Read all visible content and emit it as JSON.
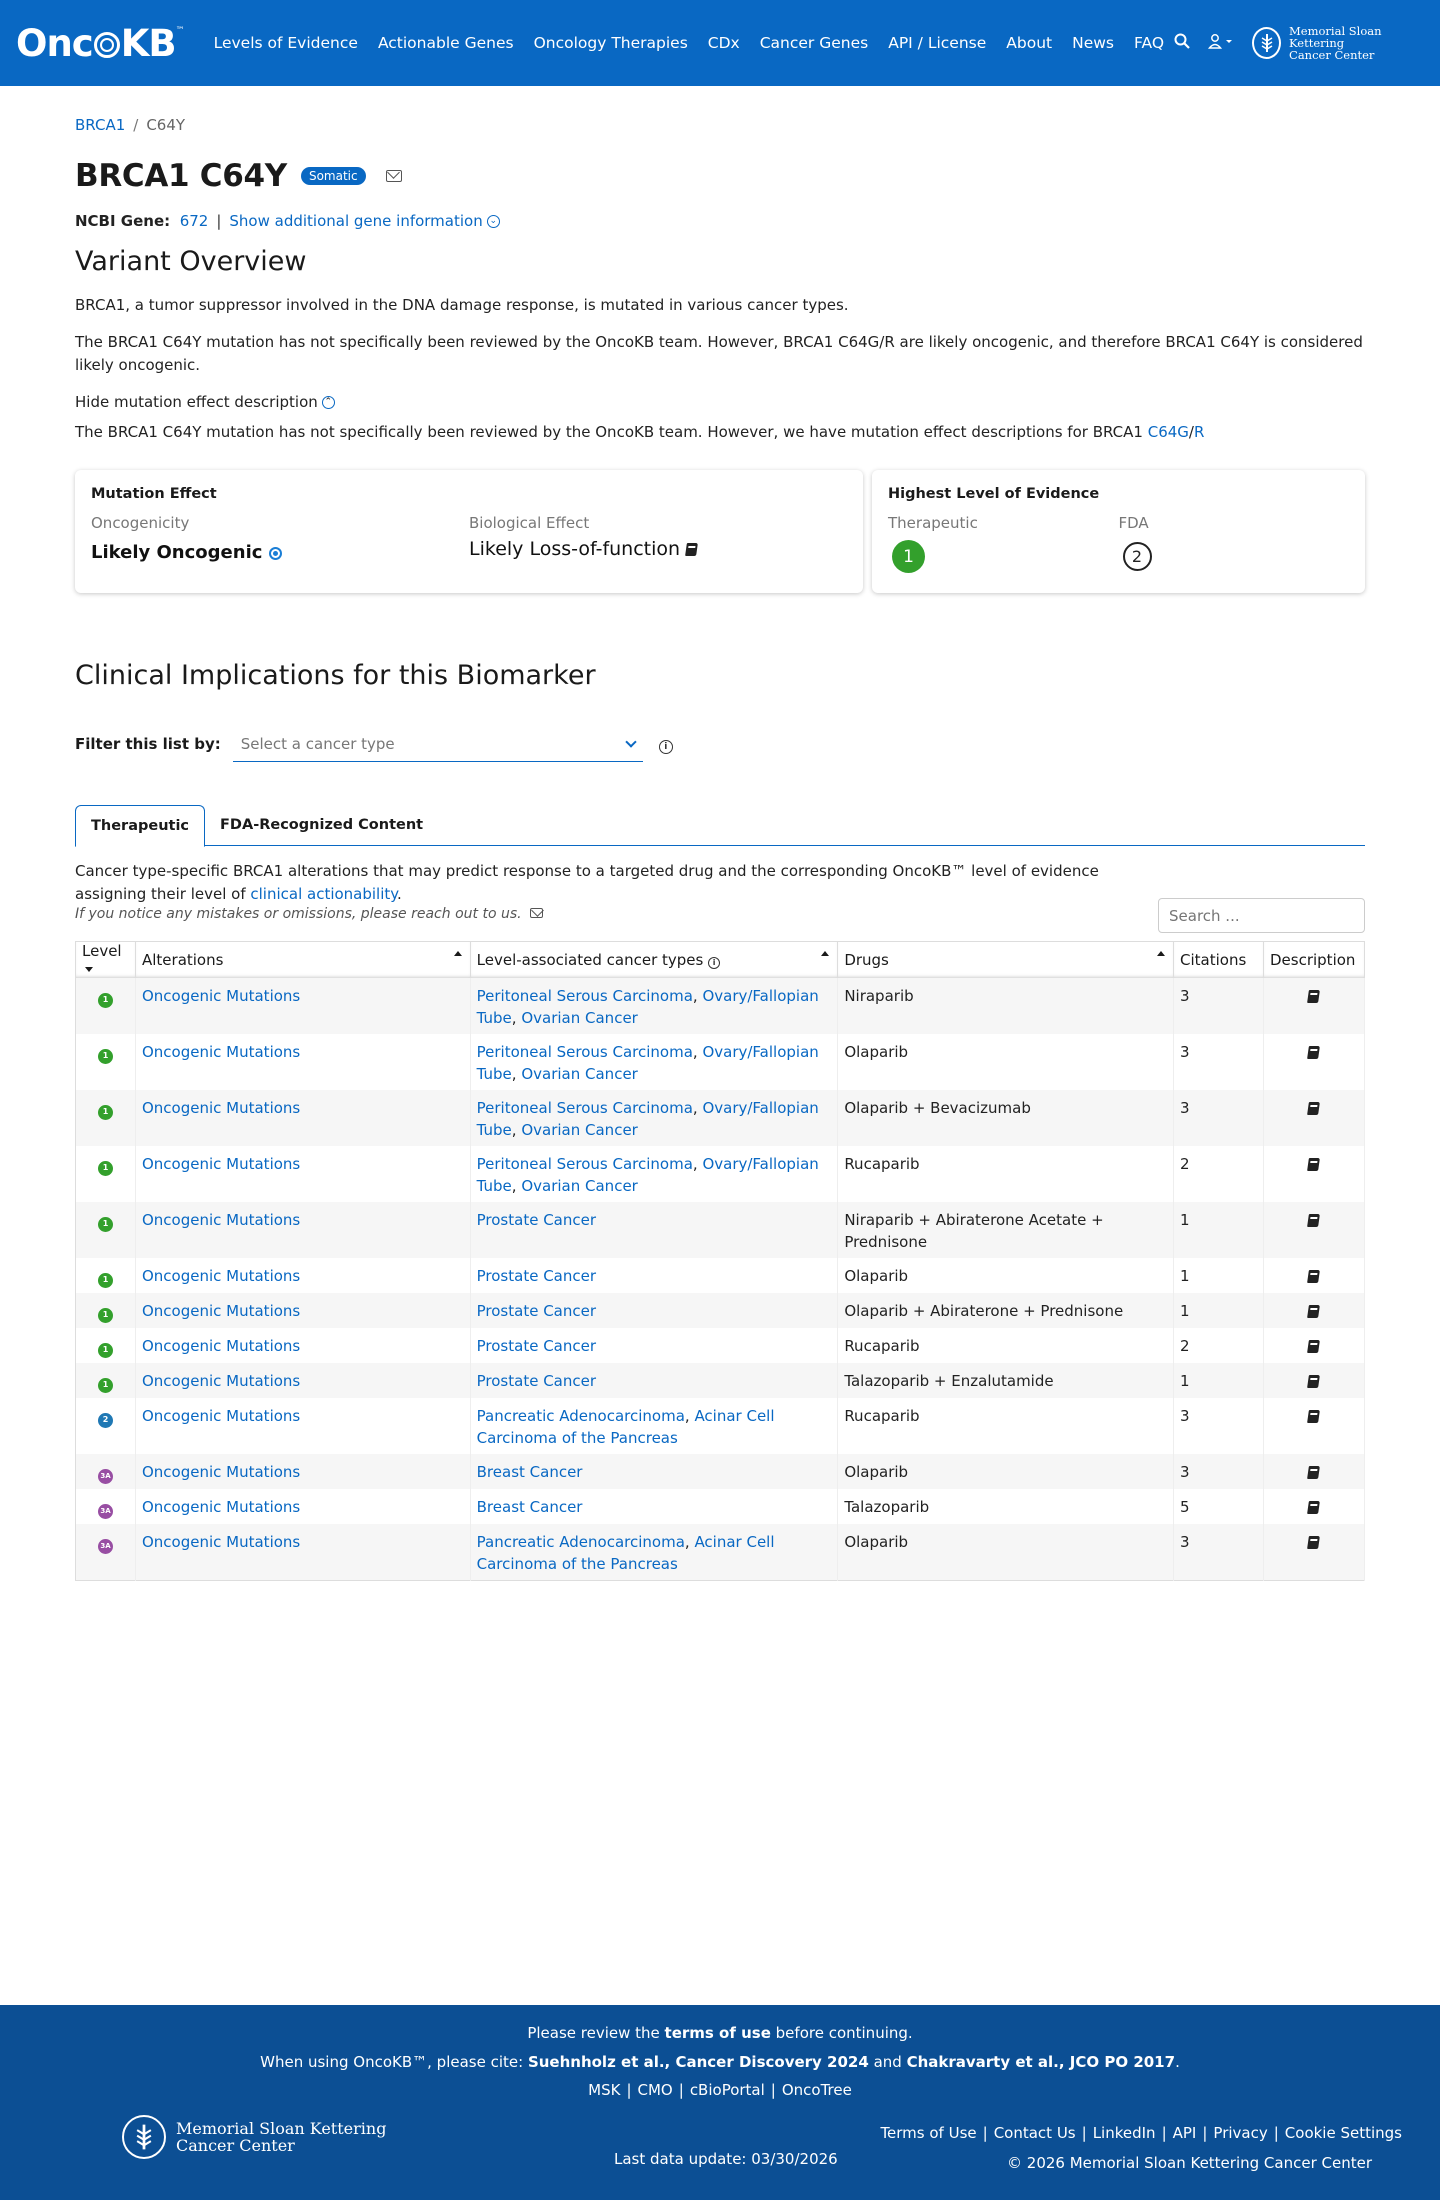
{
  "nav": {
    "logo": "OncoKB",
    "items": [
      "Levels of Evidence",
      "Actionable Genes",
      "Oncology Therapies",
      "CDx",
      "Cancer Genes",
      "API / License",
      "About",
      "News",
      "FAQ"
    ],
    "msk": [
      "Memorial Sloan Kettering",
      "Cancer Center"
    ]
  },
  "breadcrumb": {
    "gene": "BRCA1",
    "sep": "/",
    "variant": "C64Y"
  },
  "title": {
    "name": "BRCA1 C64Y",
    "badge": "Somatic"
  },
  "ncbi": {
    "label": "NCBI Gene:",
    "id": "672",
    "pipe": "|",
    "more": "Show additional gene information"
  },
  "overview": {
    "heading": "Variant Overview",
    "p1": "BRCA1, a tumor suppressor involved in the DNA damage response, is mutated in various cancer types.",
    "p2": "The BRCA1 C64Y mutation has not specifically been reviewed by the OncoKB team. However, BRCA1 C64G/R are likely oncogenic, and therefore BRCA1 C64Y is considered likely oncogenic.",
    "toggle": "Hide mutation effect description",
    "p3_prefix": "The BRCA1 C64Y mutation has not specifically been reviewed by the OncoKB team. However, we have mutation effect descriptions for BRCA1 ",
    "p3_link1": "C64G",
    "p3_sep": "/",
    "p3_link2": "R"
  },
  "mutation_card": {
    "title": "Mutation Effect",
    "oncogenicity_label": "Oncogenicity",
    "oncogenicity_value": "Likely Oncogenic",
    "bio_label": "Biological Effect",
    "bio_value": "Likely Loss-of-function"
  },
  "evidence_card": {
    "title": "Highest Level of Evidence",
    "therapeutic_label": "Therapeutic",
    "therapeutic_level": "1",
    "fda_label": "FDA",
    "fda_level": "2"
  },
  "clinical": {
    "heading": "Clinical Implications for this Biomarker",
    "filter_label": "Filter this list by:",
    "filter_placeholder": "Select a cancer type",
    "tabs": [
      "Therapeutic",
      "FDA-Recognized Content"
    ],
    "desc_prefix": "Cancer type-specific BRCA1 alterations that may predict response to a targeted drug and the corresponding OncoKB™ level of evidence assigning their level of ",
    "desc_link": "clinical actionability",
    "desc_suffix": ".",
    "note": "If you notice any mistakes or omissions, please reach out to us.",
    "search_placeholder": "Search ..."
  },
  "table": {
    "headers": [
      "Level",
      "Alterations",
      "Level-associated cancer types",
      "Drugs",
      "Citations",
      "Description"
    ],
    "rows": [
      {
        "level": "1",
        "alteration": "Oncogenic Mutations",
        "cancers": [
          "Peritoneal Serous Carcinoma",
          "Ovary/Fallopian Tube",
          "Ovarian Cancer"
        ],
        "drugs": "Niraparib",
        "citations": "3"
      },
      {
        "level": "1",
        "alteration": "Oncogenic Mutations",
        "cancers": [
          "Peritoneal Serous Carcinoma",
          "Ovary/Fallopian Tube",
          "Ovarian Cancer"
        ],
        "drugs": "Olaparib",
        "citations": "3"
      },
      {
        "level": "1",
        "alteration": "Oncogenic Mutations",
        "cancers": [
          "Peritoneal Serous Carcinoma",
          "Ovary/Fallopian Tube",
          "Ovarian Cancer"
        ],
        "drugs": "Olaparib + Bevacizumab",
        "citations": "3"
      },
      {
        "level": "1",
        "alteration": "Oncogenic Mutations",
        "cancers": [
          "Peritoneal Serous Carcinoma",
          "Ovary/Fallopian Tube",
          "Ovarian Cancer"
        ],
        "drugs": "Rucaparib",
        "citations": "2"
      },
      {
        "level": "1",
        "alteration": "Oncogenic Mutations",
        "cancers": [
          "Prostate Cancer"
        ],
        "drugs": "Niraparib + Abiraterone Acetate + Prednisone",
        "citations": "1"
      },
      {
        "level": "1",
        "alteration": "Oncogenic Mutations",
        "cancers": [
          "Prostate Cancer"
        ],
        "drugs": "Olaparib",
        "citations": "1"
      },
      {
        "level": "1",
        "alteration": "Oncogenic Mutations",
        "cancers": [
          "Prostate Cancer"
        ],
        "drugs": "Olaparib + Abiraterone + Prednisone",
        "citations": "1"
      },
      {
        "level": "1",
        "alteration": "Oncogenic Mutations",
        "cancers": [
          "Prostate Cancer"
        ],
        "drugs": "Rucaparib",
        "citations": "2"
      },
      {
        "level": "1",
        "alteration": "Oncogenic Mutations",
        "cancers": [
          "Prostate Cancer"
        ],
        "drugs": "Talazoparib + Enzalutamide",
        "citations": "1"
      },
      {
        "level": "2",
        "alteration": "Oncogenic Mutations",
        "cancers": [
          "Pancreatic Adenocarcinoma",
          "Acinar Cell Carcinoma of the Pancreas"
        ],
        "drugs": "Rucaparib",
        "citations": "3"
      },
      {
        "level": "3A",
        "alteration": "Oncogenic Mutations",
        "cancers": [
          "Breast Cancer"
        ],
        "drugs": "Olaparib",
        "citations": "3"
      },
      {
        "level": "3A",
        "alteration": "Oncogenic Mutations",
        "cancers": [
          "Breast Cancer"
        ],
        "drugs": "Talazoparib",
        "citations": "5"
      },
      {
        "level": "3A",
        "alteration": "Oncogenic Mutations",
        "cancers": [
          "Pancreatic Adenocarcinoma",
          "Acinar Cell Carcinoma of the Pancreas"
        ],
        "drugs": "Olaparib",
        "citations": "3"
      }
    ]
  },
  "footer": {
    "line1_prefix": "Please review the ",
    "line1_bold": "terms of use",
    "line1_suffix": " before continuing.",
    "line2_prefix": "When using OncoKB™, please cite: ",
    "line2_bold1": "Suehnholz et al., Cancer Discovery 2024",
    "line2_mid": " and ",
    "line2_bold2": "Chakravarty et al., JCO PO 2017",
    "line2_suffix": ".",
    "line3": [
      "MSK",
      "CMO",
      "cBioPortal",
      "OncoTree"
    ],
    "msk": [
      "Memorial Sloan Kettering",
      "Cancer Center"
    ],
    "updated": "Last data update: 03/30/2026",
    "links": [
      "Terms of Use",
      "Contact Us",
      "LinkedIn",
      "API",
      "Privacy",
      "Cookie Settings"
    ],
    "copyright": "© 2026 Memorial Sloan Kettering Cancer Center"
  },
  "colors": {
    "brand": "#0968c3",
    "footer": "#0c4f94",
    "level1": "#33a02c",
    "level2": "#1f78b4",
    "level3A": "#984ea3"
  }
}
